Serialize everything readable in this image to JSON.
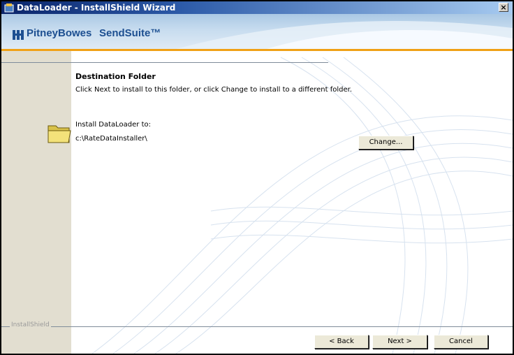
{
  "window": {
    "title": "DataLoader - InstallShield Wizard",
    "close_glyph": "×"
  },
  "banner": {
    "brand": "PitneyBowes",
    "product": "SendSuite™"
  },
  "page": {
    "heading": "Destination Folder",
    "subheading": "Click Next to install to this folder, or click Change to install to a different folder.",
    "install_label": "Install DataLoader to:",
    "install_path": "c:\\RateDataInstaller\\"
  },
  "buttons": {
    "change": "Change...",
    "back": "< Back",
    "next": "Next >",
    "cancel": "Cancel"
  },
  "footer": {
    "brand": "InstallShield"
  },
  "colors": {
    "accent_orange": "#f0a116",
    "brand_blue": "#1d4f91",
    "band": "#e2ded0"
  },
  "icons": [
    "installer-icon",
    "pitney-bowes-logo-icon",
    "folder-icon",
    "close-icon"
  ]
}
